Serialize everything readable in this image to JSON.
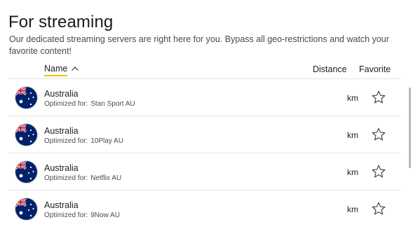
{
  "section": {
    "title": "For streaming",
    "description": "Our dedicated streaming servers are right here for you. Bypass all geo-restrictions and watch your favorite content!"
  },
  "columns": {
    "name": "Name",
    "distance": "Distance",
    "favorite": "Favorite",
    "sort_icon": "chevron-up-icon"
  },
  "servers": [
    {
      "country": "Australia",
      "optimized_label": "Optimized for:",
      "service": "Stan Sport AU",
      "distance": "km",
      "flag_icon": "australia-flag-icon",
      "favorite_icon": "star-outline-icon"
    },
    {
      "country": "Australia",
      "optimized_label": "Optimized for:",
      "service": "10Play AU",
      "distance": "km",
      "flag_icon": "australia-flag-icon",
      "favorite_icon": "star-outline-icon"
    },
    {
      "country": "Australia",
      "optimized_label": "Optimized for:",
      "service": "Netflix AU",
      "distance": "km",
      "flag_icon": "australia-flag-icon",
      "favorite_icon": "star-outline-icon"
    },
    {
      "country": "Australia",
      "optimized_label": "Optimized for:",
      "service": "9Now AU",
      "distance": "km",
      "flag_icon": "australia-flag-icon",
      "favorite_icon": "star-outline-icon"
    }
  ],
  "colors": {
    "sort_underline": "#f2c200",
    "flag_blue": "#012169",
    "flag_red": "#c8102e"
  }
}
